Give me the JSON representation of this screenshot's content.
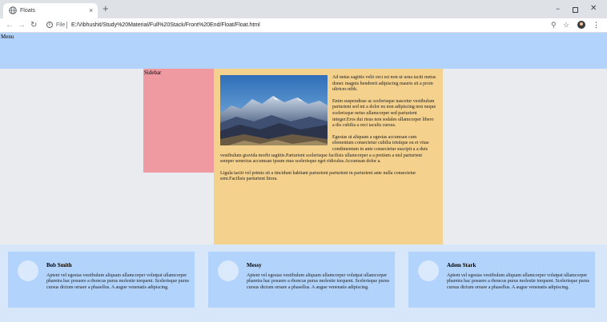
{
  "browser": {
    "tab_title": "Floats",
    "tab_close": "×",
    "new_tab": "+",
    "minimize": "−",
    "close": "✕",
    "scheme_label": "File",
    "url": "E:/Vibhushit/Study%20Material/Full%20Stack/Front%20End/Float/Float.html",
    "icons": {
      "back": "back-arrow-icon",
      "forward": "forward-arrow-icon",
      "reload": "reload-icon",
      "info": "info-icon",
      "zoom": "zoom-icon",
      "star": "star-icon",
      "profile": "profile-avatar-icon",
      "menu": "kebab-menu-icon"
    }
  },
  "page": {
    "menu_label": "Menu",
    "sidebar_label": "Sidebar",
    "article": {
      "paragraphs": [
        "Ad netus sagittis velit orci est non ut urna taciti metus donec magnis hendrerit adipiscing mauris sit a proin ultrices nibh.",
        "Enim suspendisse ac scelerisque nascetur vestibulum parturient sed mi a dolor eu non adipiscing non neque scelerisque netus ullamcorper sed parturient integer.Eros dui risus non sodales ullamcorper libero a dis cubilia a orci iaculis cursus.",
        "Egestas ut aliquam a egestas accumsan cum elementum consectetur cubilia tristique eu et vitae condimentum in ante consectetur suscipit a a duis vestibulum gravida morbi sagittis.Parturient scelerisque facilisis ullamcorper a a pretium a nisl parturient semper senectus accumsan ipsum mus scelerisque eget ridiculus.Accumsan dolor a.",
        "Ligula taciti vel primis sit a tincidunt habitant parturient parturient in parturient ante nulla consectetur sem.Facilisis parturient litora."
      ]
    },
    "cards": [
      {
        "name": "Bob Smith",
        "text": "Aptent vel egestas vestibulum aliquam ullamcorper volutpat ullamcorper pharetra hac posuere a rhoncus purus molestie torquent. Scelerisque purus cursus dictum ornare a phasellus. A augue venenatis adipiscing."
      },
      {
        "name": "Messy",
        "text": "Aptent vel egestas vestibulum aliquam ullamcorper volutpat ullamcorper pharetra hac posuere a rhoncus purus molestie torquent. Scelerisque purus cursus dictum ornare a phasellus. A augue venenatis adipiscing."
      },
      {
        "name": "Adem Stark",
        "text": "Aptent vel egestas vestibulum aliquam ullamcorper volutpat ullamcorper pharetra hac posuere a rhoncus purus molestie torquent. Scelerisque purus cursus dictum ornare a phasellus. A augue venenatis adipiscing."
      }
    ]
  },
  "colors": {
    "menu_bg": "#b2d3fb",
    "sidebar_bg": "#ef9aa0",
    "article_bg": "#f5d18e",
    "footer_bg": "#d7e7f9",
    "card_bg": "#b2d3fb",
    "page_bg": "#e9ebee"
  }
}
